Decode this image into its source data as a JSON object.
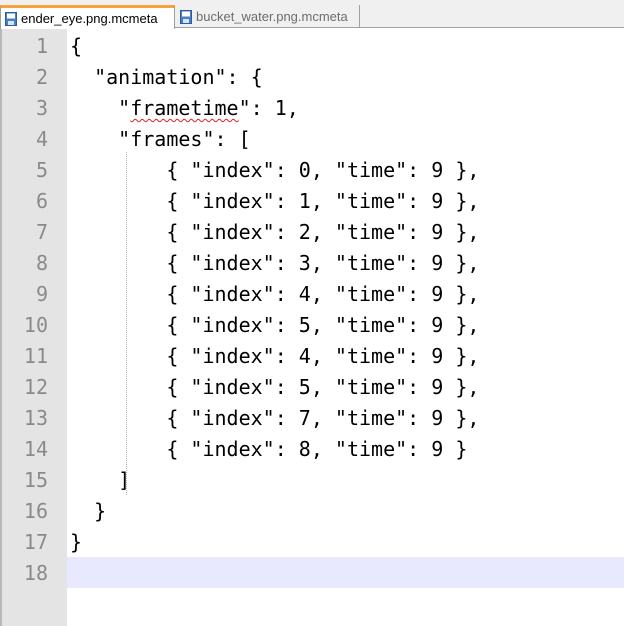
{
  "tabs": [
    {
      "label": "ender_eye.png.mcmeta",
      "active": true
    },
    {
      "label": "bucket_water.png.mcmeta",
      "active": false
    }
  ],
  "colors": {
    "active_tab_accent": "#f7a23a",
    "gutter_bg": "#e4e4e4",
    "current_line_bg": "#e8e8ff"
  },
  "editor": {
    "current_line": 18,
    "lines": [
      {
        "num": "1",
        "text": "{"
      },
      {
        "num": "2",
        "text": "  \"animation\": {"
      },
      {
        "num": "3",
        "pre": "    \"",
        "word": "frametime",
        "post": "\": 1,"
      },
      {
        "num": "4",
        "text": "    \"frames\": ["
      },
      {
        "num": "5",
        "text": "        { \"index\": 0, \"time\": 9 },"
      },
      {
        "num": "6",
        "text": "        { \"index\": 1, \"time\": 9 },"
      },
      {
        "num": "7",
        "text": "        { \"index\": 2, \"time\": 9 },"
      },
      {
        "num": "8",
        "text": "        { \"index\": 3, \"time\": 9 },"
      },
      {
        "num": "9",
        "text": "        { \"index\": 4, \"time\": 9 },"
      },
      {
        "num": "10",
        "text": "        { \"index\": 5, \"time\": 9 },"
      },
      {
        "num": "11",
        "text": "        { \"index\": 4, \"time\": 9 },"
      },
      {
        "num": "12",
        "text": "        { \"index\": 5, \"time\": 9 },"
      },
      {
        "num": "13",
        "text": "        { \"index\": 7, \"time\": 9 },"
      },
      {
        "num": "14",
        "text": "        { \"index\": 8, \"time\": 9 }"
      },
      {
        "num": "15",
        "text": "    ]"
      },
      {
        "num": "16",
        "text": "  }"
      },
      {
        "num": "17",
        "text": "}"
      },
      {
        "num": "18",
        "text": ""
      }
    ]
  }
}
